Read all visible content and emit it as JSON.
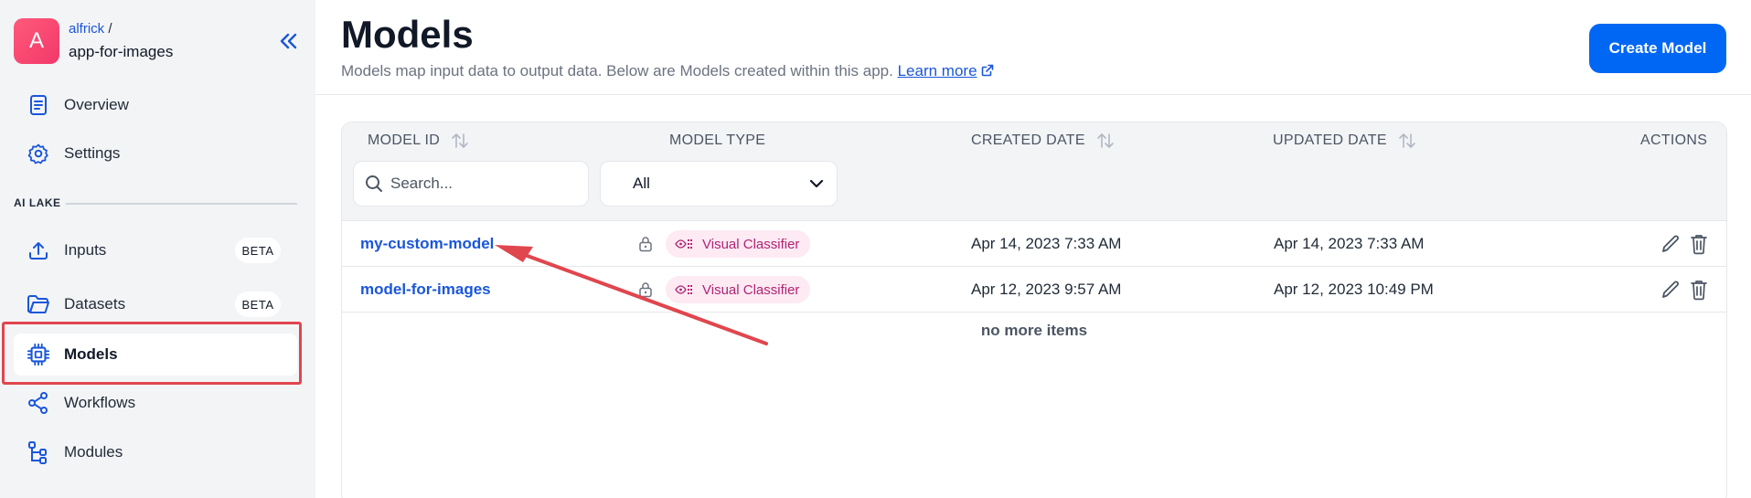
{
  "sidebar": {
    "app": {
      "avatar_letter": "A",
      "owner": "alfrick",
      "separator": " /",
      "name": "app-for-images"
    },
    "top_items": [
      {
        "label": "Overview",
        "icon": "document-icon"
      },
      {
        "label": "Settings",
        "icon": "gear-icon"
      }
    ],
    "section_label": "AI LAKE",
    "items": [
      {
        "label": "Inputs",
        "icon": "upload-icon",
        "badge": "BETA"
      },
      {
        "label": "Datasets",
        "icon": "folder-icon",
        "badge": "BETA"
      },
      {
        "label": "Models",
        "icon": "chip-icon",
        "active": true
      },
      {
        "label": "Workflows",
        "icon": "share-nodes-icon"
      },
      {
        "label": "Modules",
        "icon": "tree-icon"
      }
    ]
  },
  "header": {
    "title": "Models",
    "subtitle": "Models map input data to output data. Below are Models created within this app.",
    "learn_more": "Learn more",
    "create_button": "Create Model"
  },
  "table": {
    "columns": [
      "MODEL ID",
      "MODEL TYPE",
      "CREATED DATE",
      "UPDATED DATE",
      "ACTIONS"
    ],
    "search_placeholder": "Search...",
    "type_filter": "All",
    "rows": [
      {
        "id": "my-custom-model",
        "type": "Visual Classifier",
        "created": "Apr 14, 2023 7:33 AM",
        "updated": "Apr 14, 2023 7:33 AM"
      },
      {
        "id": "model-for-images",
        "type": "Visual Classifier",
        "created": "Apr 12, 2023 9:57 AM",
        "updated": "Apr 12, 2023 10:49 PM"
      }
    ],
    "footer": "no more items"
  },
  "colors": {
    "primary": "#0067f5",
    "link": "#1a56db",
    "tag_bg": "#fdeaf3",
    "tag_text": "#b12373",
    "annotation": "#e0464e"
  }
}
